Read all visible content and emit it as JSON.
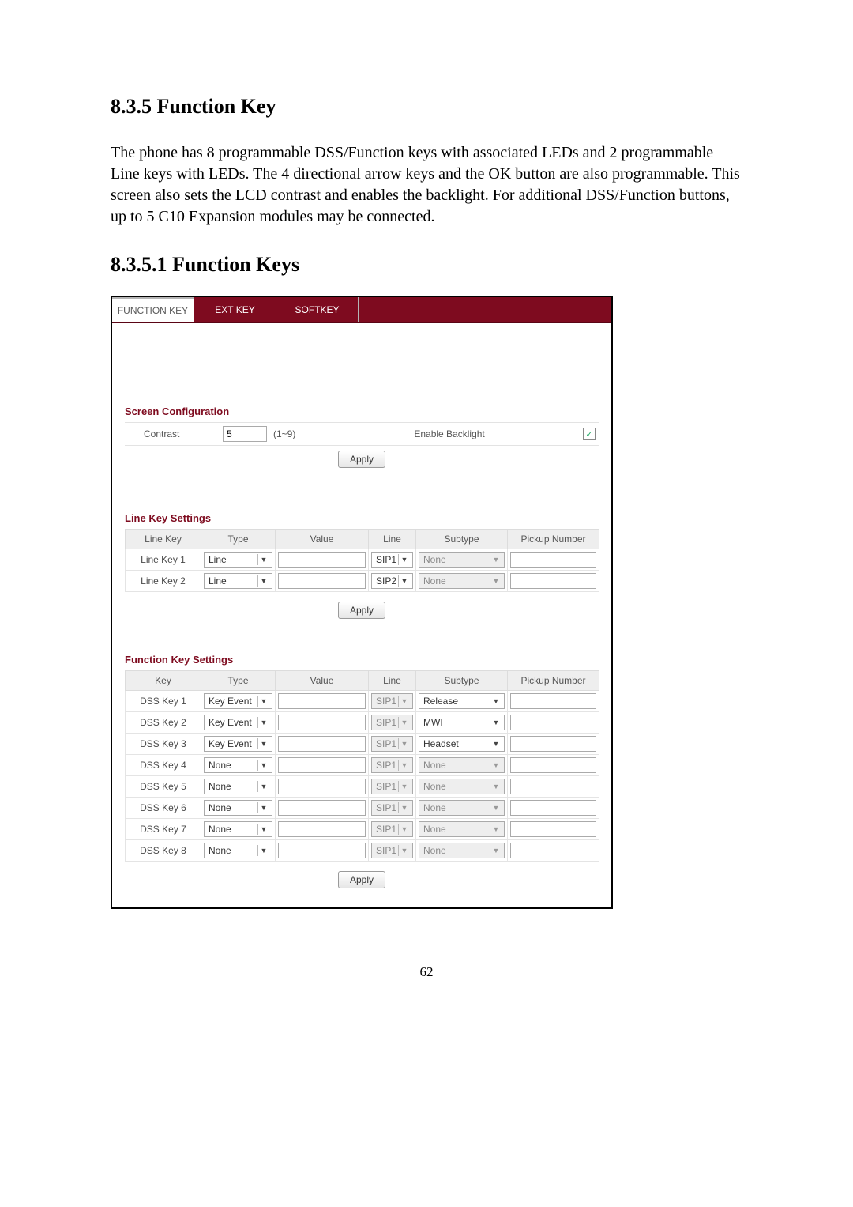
{
  "headings": {
    "h1": "8.3.5    Function Key",
    "paragraph": "The phone has 8 programmable DSS/Function keys with associated LEDs and 2 programmable Line keys with LEDs. The 4 directional arrow keys and the OK button are also programmable. This screen also sets the LCD contrast and enables the backlight.    For additional DSS/Function buttons, up to 5 C10 Expansion modules may be connected.",
    "h2": "8.3.5.1    Function Keys"
  },
  "tabs": {
    "function": "FUNCTION KEY",
    "ext": "EXT KEY",
    "soft": "SOFTKEY"
  },
  "screen_cfg": {
    "title": "Screen Configuration",
    "contrast_label": "Contrast",
    "contrast_value": "5",
    "contrast_hint": "(1~9)",
    "backlight_label": "Enable Backlight",
    "backlight_checked": "✓",
    "apply": "Apply"
  },
  "line_keys": {
    "title": "Line Key Settings",
    "headers": {
      "key": "Line Key",
      "type": "Type",
      "value": "Value",
      "line": "Line",
      "subtype": "Subtype",
      "pickup": "Pickup Number"
    },
    "rows": [
      {
        "key": "Line Key 1",
        "type": "Line",
        "value": "",
        "line": "SIP1",
        "subtype": "None",
        "sub_disabled": true,
        "pickup": ""
      },
      {
        "key": "Line Key 2",
        "type": "Line",
        "value": "",
        "line": "SIP2",
        "subtype": "None",
        "sub_disabled": true,
        "pickup": ""
      }
    ],
    "apply": "Apply"
  },
  "fn_keys": {
    "title": "Function Key Settings",
    "headers": {
      "key": "Key",
      "type": "Type",
      "value": "Value",
      "line": "Line",
      "subtype": "Subtype",
      "pickup": "Pickup Number"
    },
    "rows": [
      {
        "key": "DSS Key 1",
        "type": "Key Event",
        "value": "",
        "line": "SIP1",
        "line_disabled": true,
        "subtype": "Release",
        "sub_disabled": false,
        "pickup": ""
      },
      {
        "key": "DSS Key 2",
        "type": "Key Event",
        "value": "",
        "line": "SIP1",
        "line_disabled": true,
        "subtype": "MWI",
        "sub_disabled": false,
        "pickup": ""
      },
      {
        "key": "DSS Key 3",
        "type": "Key Event",
        "value": "",
        "line": "SIP1",
        "line_disabled": true,
        "subtype": "Headset",
        "sub_disabled": false,
        "pickup": ""
      },
      {
        "key": "DSS Key 4",
        "type": "None",
        "value": "",
        "line": "SIP1",
        "line_disabled": true,
        "subtype": "None",
        "sub_disabled": true,
        "pickup": ""
      },
      {
        "key": "DSS Key 5",
        "type": "None",
        "value": "",
        "line": "SIP1",
        "line_disabled": true,
        "subtype": "None",
        "sub_disabled": true,
        "pickup": ""
      },
      {
        "key": "DSS Key 6",
        "type": "None",
        "value": "",
        "line": "SIP1",
        "line_disabled": true,
        "subtype": "None",
        "sub_disabled": true,
        "pickup": ""
      },
      {
        "key": "DSS Key 7",
        "type": "None",
        "value": "",
        "line": "SIP1",
        "line_disabled": true,
        "subtype": "None",
        "sub_disabled": true,
        "pickup": ""
      },
      {
        "key": "DSS Key 8",
        "type": "None",
        "value": "",
        "line": "SIP1",
        "line_disabled": true,
        "subtype": "None",
        "sub_disabled": true,
        "pickup": ""
      }
    ],
    "apply": "Apply"
  },
  "page_number": "62"
}
